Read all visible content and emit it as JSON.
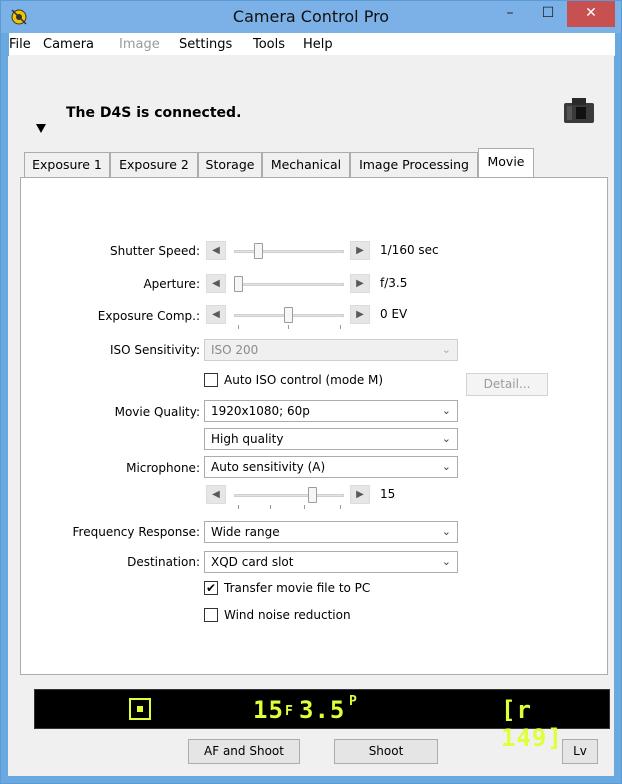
{
  "window": {
    "title": "Camera Control Pro",
    "minimize_glyph": "–",
    "maximize_glyph": "☐",
    "close_glyph": "✕"
  },
  "menu": [
    "File",
    "Camera",
    "Image",
    "Settings",
    "Tools",
    "Help"
  ],
  "status": {
    "connected_text": "The D4S is connected."
  },
  "tabs": [
    "Exposure 1",
    "Exposure 2",
    "Storage",
    "Mechanical",
    "Image Processing",
    "Movie"
  ],
  "active_tab": "Movie",
  "movie": {
    "shutter_speed": {
      "label": "Shutter Speed:",
      "value": "1/160 sec"
    },
    "aperture": {
      "label": "Aperture:",
      "value": "f/3.5"
    },
    "exposure_comp": {
      "label": "Exposure Comp.:",
      "value": "0 EV"
    },
    "iso": {
      "label": "ISO Sensitivity:",
      "value": "ISO 200"
    },
    "auto_iso": {
      "label": "Auto ISO control (mode M)",
      "checked": false
    },
    "detail_button": "Detail...",
    "movie_quality": {
      "label": "Movie Quality:",
      "value": "1920x1080; 60p",
      "quality": "High quality"
    },
    "microphone": {
      "label": "Microphone:",
      "value": "Auto sensitivity (A)",
      "level": "15"
    },
    "frequency_response": {
      "label": "Frequency Response:",
      "value": "Wide range"
    },
    "destination": {
      "label": "Destination:",
      "value": "XQD card slot"
    },
    "transfer_to_pc": {
      "label": "Transfer movie file to PC",
      "checked": true
    },
    "wind_noise": {
      "label": "Wind noise reduction",
      "checked": false
    }
  },
  "lcd": {
    "shutter": "15",
    "aperture_prefix": "F",
    "aperture": "3.5",
    "mode": "P",
    "remaining": "[r 149]"
  },
  "buttons": {
    "af_shoot": "AF and Shoot",
    "shoot": "Shoot",
    "lv": "Lv"
  },
  "glyphs": {
    "left": "◀",
    "right": "▶",
    "chevron": "⌄",
    "check": "✔",
    "expand": "▼"
  }
}
